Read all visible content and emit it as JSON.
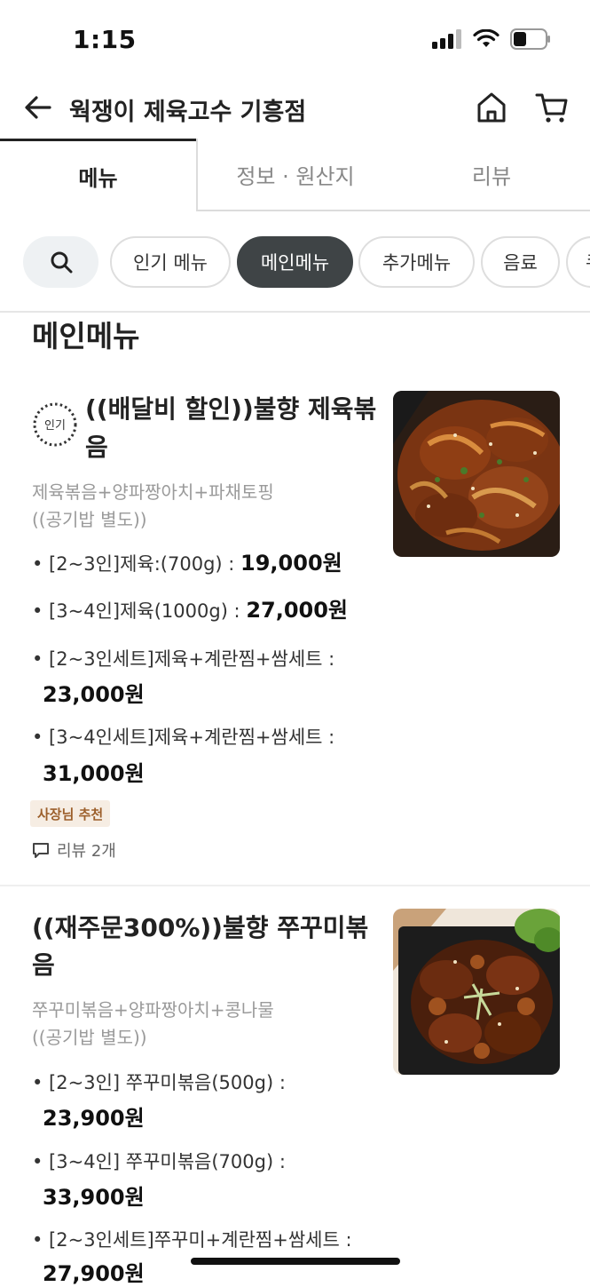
{
  "status_bar": {
    "time": "1:15"
  },
  "header": {
    "title": "웍쟁이 제육고수 기흥점"
  },
  "tabs": [
    {
      "label": "메뉴"
    },
    {
      "label": "정보 · 원산지"
    },
    {
      "label": "리뷰"
    }
  ],
  "chips": [
    {
      "label": "인기 메뉴"
    },
    {
      "label": "메인메뉴"
    },
    {
      "label": "추가메뉴"
    },
    {
      "label": "음료"
    },
    {
      "label": "쿠"
    }
  ],
  "section_title": "메인메뉴",
  "items": [
    {
      "badge": "인기",
      "title_line1": "((배달비 할인))불향 제육볶",
      "title_line2": "음",
      "desc_line1": "제육볶음+양파짱아치+파채토핑",
      "desc_line2": "((공기밥 별도))",
      "options": [
        {
          "label": "• [2~3인]제육:(700g) : ",
          "price": "19,000원"
        },
        {
          "label": "• [3~4인]제육(1000g) : ",
          "price": "27,000원"
        },
        {
          "label": "• [2~3인세트]제육+계란찜+쌈세트 :",
          "price": "23,000원"
        },
        {
          "label": "• [3~4인세트]제육+계란찜+쌈세트 :",
          "price": "31,000원"
        }
      ],
      "owner_tag": "사장님 추천",
      "review": "리뷰 2개"
    },
    {
      "title_line1": "((재주문300%))불향 쭈꾸미볶",
      "title_line2": "음",
      "desc_line1": "쭈꾸미볶음+양파짱아치+콩나물",
      "desc_line2": "((공기밥 별도))",
      "options": [
        {
          "label": "• [2~3인] 쭈꾸미볶음(500g) :",
          "price": "23,900원"
        },
        {
          "label": "• [3~4인] 쭈꾸미볶음(700g) :",
          "price": "33,900원"
        },
        {
          "label": "• [2~3인세트]쭈꾸미+계란찜+쌈세트 :",
          "price": "27,900원"
        }
      ]
    }
  ]
}
